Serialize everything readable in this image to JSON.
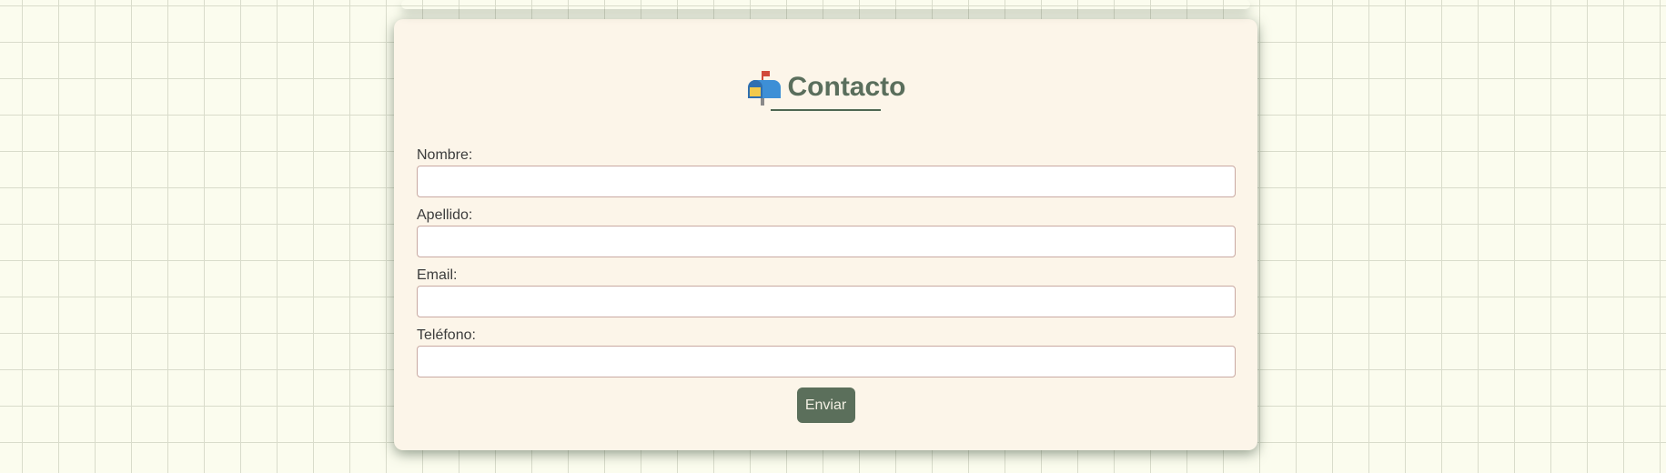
{
  "contact_form": {
    "icon": "mailbox-icon",
    "title": "Contacto",
    "fields": [
      {
        "label": "Nombre:",
        "value": ""
      },
      {
        "label": "Apellido:",
        "value": ""
      },
      {
        "label": "Email:",
        "value": ""
      },
      {
        "label": "Teléfono:",
        "value": ""
      }
    ],
    "submit_label": "Enviar"
  },
  "colors": {
    "background": "#fbfcee",
    "card": "#fcf5e9",
    "title": "#5a6e5c",
    "button": "#5b6f5b",
    "input_border": "#c9a9a2"
  }
}
